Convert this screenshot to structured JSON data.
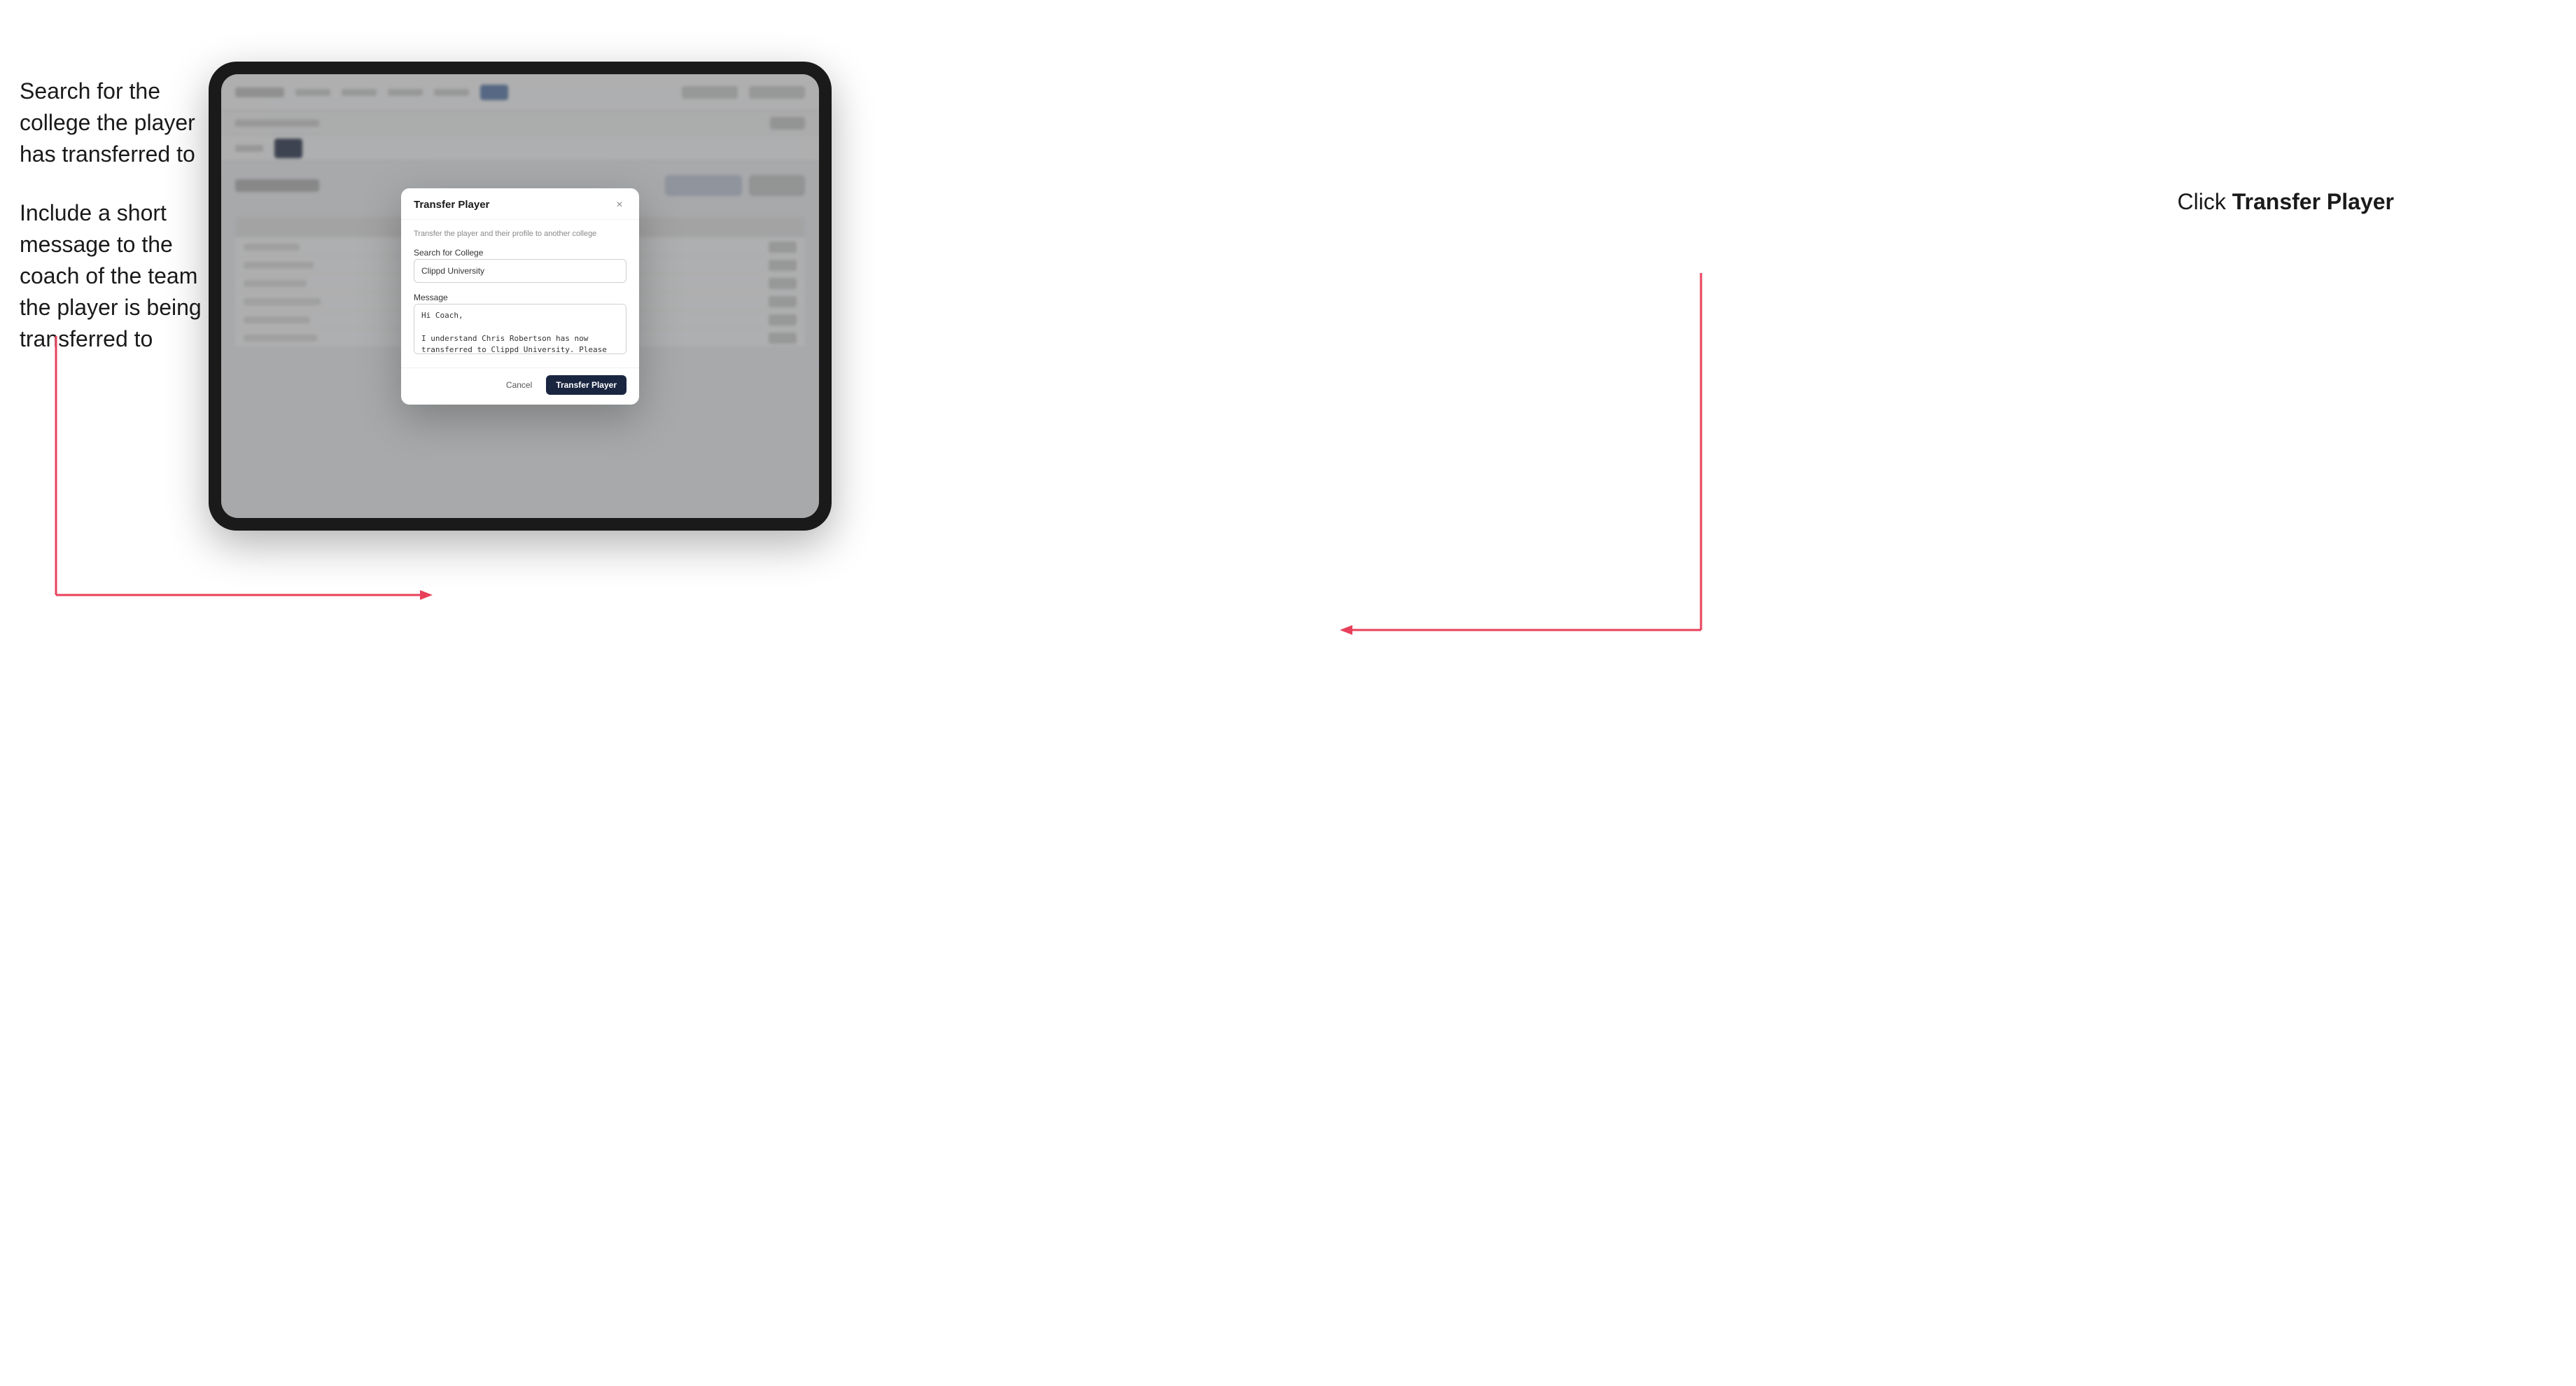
{
  "annotations": {
    "left_top": "Search for the college the player has transferred to",
    "left_bottom": "Include a short message to the coach of the team the player is being transferred to",
    "right": "Click ",
    "right_bold": "Transfer Player"
  },
  "tablet": {
    "nav": {
      "logo_text": "CLIPPD",
      "items": [
        "COMMUNITY",
        "TOOLS",
        "FEATURES",
        "ANALYTICS",
        "ROSTER"
      ],
      "active_item": "ROSTER"
    },
    "breadcrumb": "Basketball (35)",
    "action_right": "Create 1",
    "tabs": [
      "TEAM",
      "ROSTER"
    ],
    "active_tab": "ROSTER",
    "page_title": "Update Roster",
    "action_buttons": [
      "+ Add Position",
      "+ Add Player"
    ],
    "table": {
      "columns": [
        "Role"
      ],
      "rows": [
        {
          "name": "Starting Lineup",
          "action": ""
        },
        {
          "name": "Chris Robertson",
          "action": "• Edit"
        },
        {
          "name": "Michael James",
          "action": "• Edit"
        },
        {
          "name": "Jordan Smith",
          "action": "• Edit"
        },
        {
          "name": "Aaron Williams",
          "action": "• Edit"
        },
        {
          "name": "Marcus Davis",
          "action": "• Edit"
        }
      ]
    }
  },
  "dialog": {
    "title": "Transfer Player",
    "close_label": "×",
    "subtitle": "Transfer the player and their profile to another college",
    "college_label": "Search for College",
    "college_value": "Clippd University",
    "message_label": "Message",
    "message_value": "Hi Coach,\n\nI understand Chris Robertson has now transferred to Clippd University. Please accept this transfer request when you can.",
    "cancel_label": "Cancel",
    "transfer_label": "Transfer Player"
  }
}
